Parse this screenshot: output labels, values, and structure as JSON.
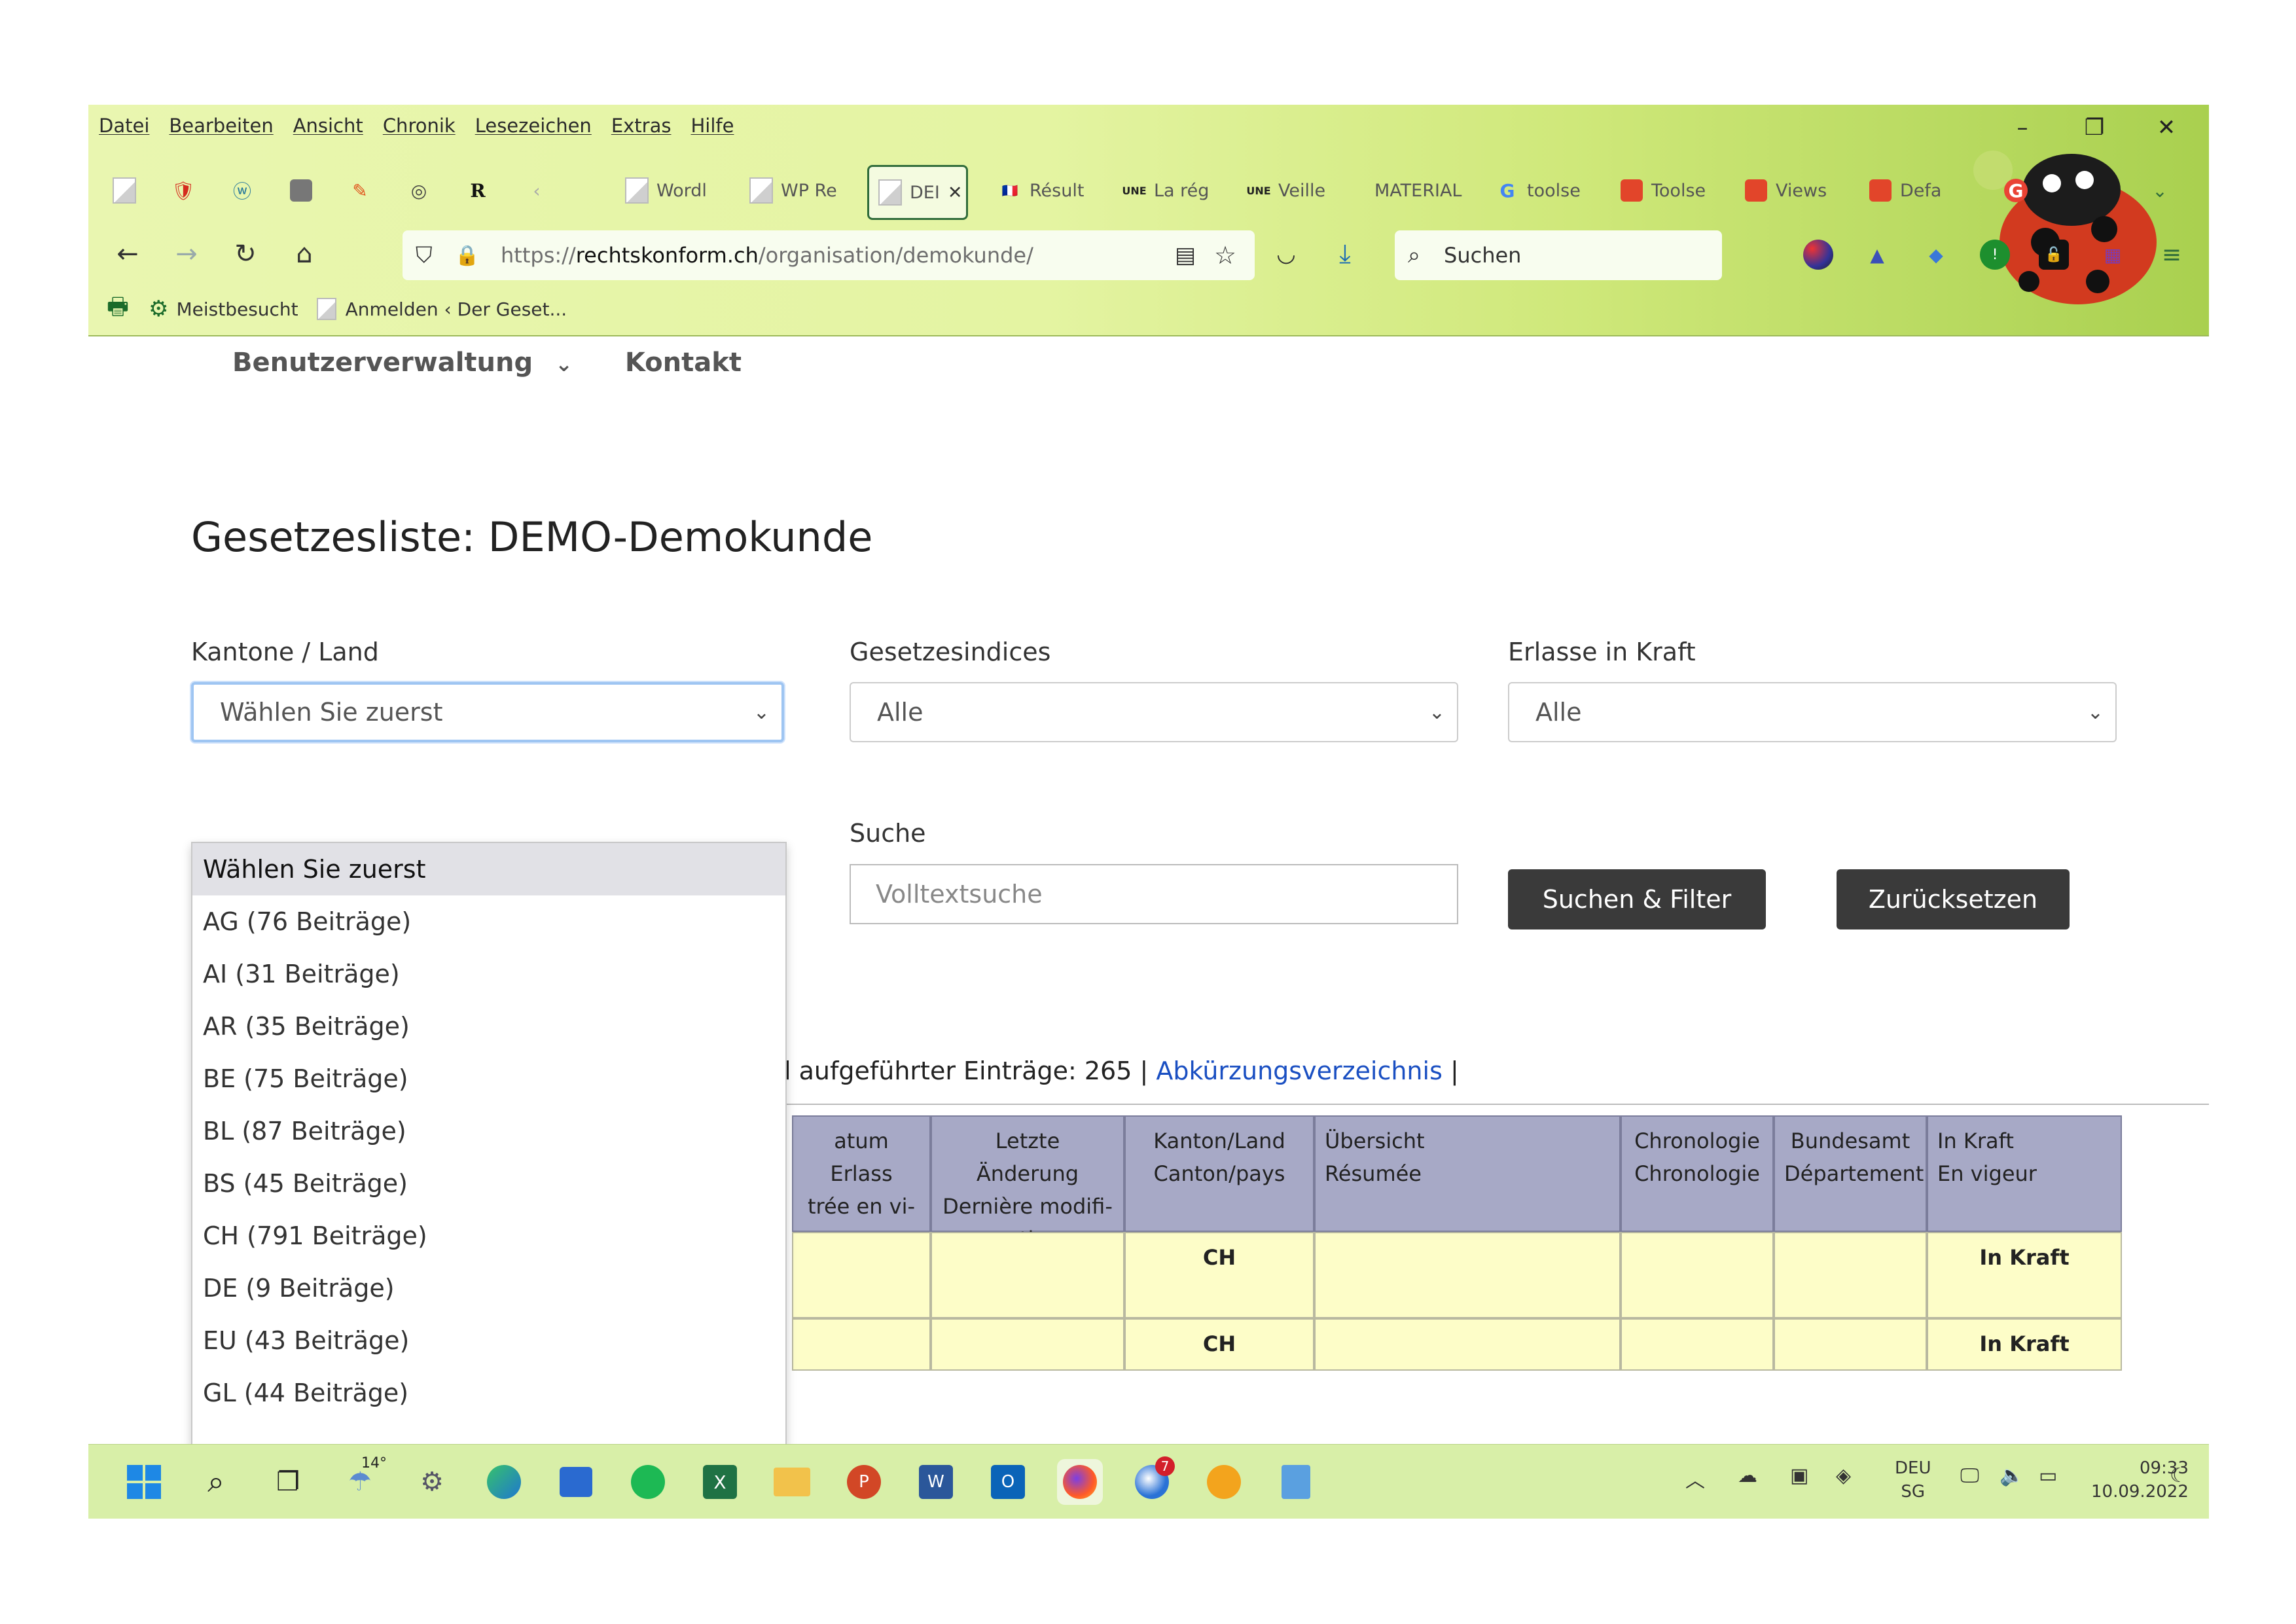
{
  "menu": [
    "Datei",
    "Bearbeiten",
    "Ansicht",
    "Chronik",
    "Lesezeichen",
    "Extras",
    "Hilfe"
  ],
  "tabs": [
    {
      "label": "Wordl"
    },
    {
      "label": "WP Re"
    },
    {
      "label": "DEI"
    },
    {
      "label": "Résult"
    },
    {
      "label": "La rég"
    },
    {
      "label": "Veille"
    },
    {
      "label": "MATERIAL"
    },
    {
      "label": "toolse"
    },
    {
      "label": "Toolse"
    },
    {
      "label": "Views"
    },
    {
      "label": "Defa"
    }
  ],
  "pinned_badge": "R",
  "url": {
    "prefix": "https://",
    "domain": "rechtskonform.ch",
    "path": "/organisation/demokunde/"
  },
  "search_placeholder": "Suchen",
  "bookmarks": [
    "Meistbesucht",
    "Anmelden ‹ Der Geset..."
  ],
  "site_nav": {
    "item1": "Benutzerverwaltung",
    "item1_chevron": "⌄",
    "item2": "Kontakt"
  },
  "page_title": "Gesetzesliste: DEMO-Demokunde",
  "filters": {
    "kantone_label": "Kantone / Land",
    "kantone_value": "Wählen Sie zuerst",
    "indices_label": "Gesetzesindices",
    "indices_value": "Alle",
    "kraft_label": "Erlasse in Kraft",
    "kraft_value": "Alle",
    "suche_label": "Suche",
    "suche_placeholder": "Volltextsuche",
    "search_button": "Suchen & Filter",
    "reset_button": "Zurücksetzen"
  },
  "summary": {
    "text": "l aufgeführter Einträge: 265 |",
    "link": "Abkürzungsverzeichnis",
    "tail": "|"
  },
  "table": {
    "headers": [
      "atum Erlass\ntrée en vi-\ngueur",
      "Letzte Änderung\nDernière modifi-\ncation",
      "Kanton/Land\nCanton/pays",
      "Übersicht\nRésumée",
      "Chronologie\nChronologie",
      "Bundesamt\nDépartement",
      "In Kraft\nEn vigeur"
    ],
    "row1": {
      "kanton": "CH",
      "status": "In Kraft"
    },
    "row2": {
      "kanton": "CH",
      "status": "In Kraft"
    }
  },
  "dropdown_options": [
    "Wählen Sie zuerst",
    "AG (76 Beiträge)",
    "AI (31 Beiträge)",
    "AR (35 Beiträge)",
    "BE (75 Beiträge)",
    "BL (87 Beiträge)",
    "BS (45 Beiträge)",
    "CH (791 Beiträge)",
    "DE (9 Beiträge)",
    "EU (43 Beiträge)",
    "GL (44 Beiträge)"
  ],
  "taskbar": {
    "weather": "14°",
    "thunderbird_badge": "7",
    "lang": "DEU",
    "region": "SG",
    "time": "09:33",
    "date": "10.09.2022"
  },
  "colors": {
    "chrome_bg": "#e4f4a2",
    "table_header": "#a7a9c6",
    "table_cell": "#fdfdc8",
    "button": "#3a3a3a",
    "link": "#1a4fc2"
  }
}
